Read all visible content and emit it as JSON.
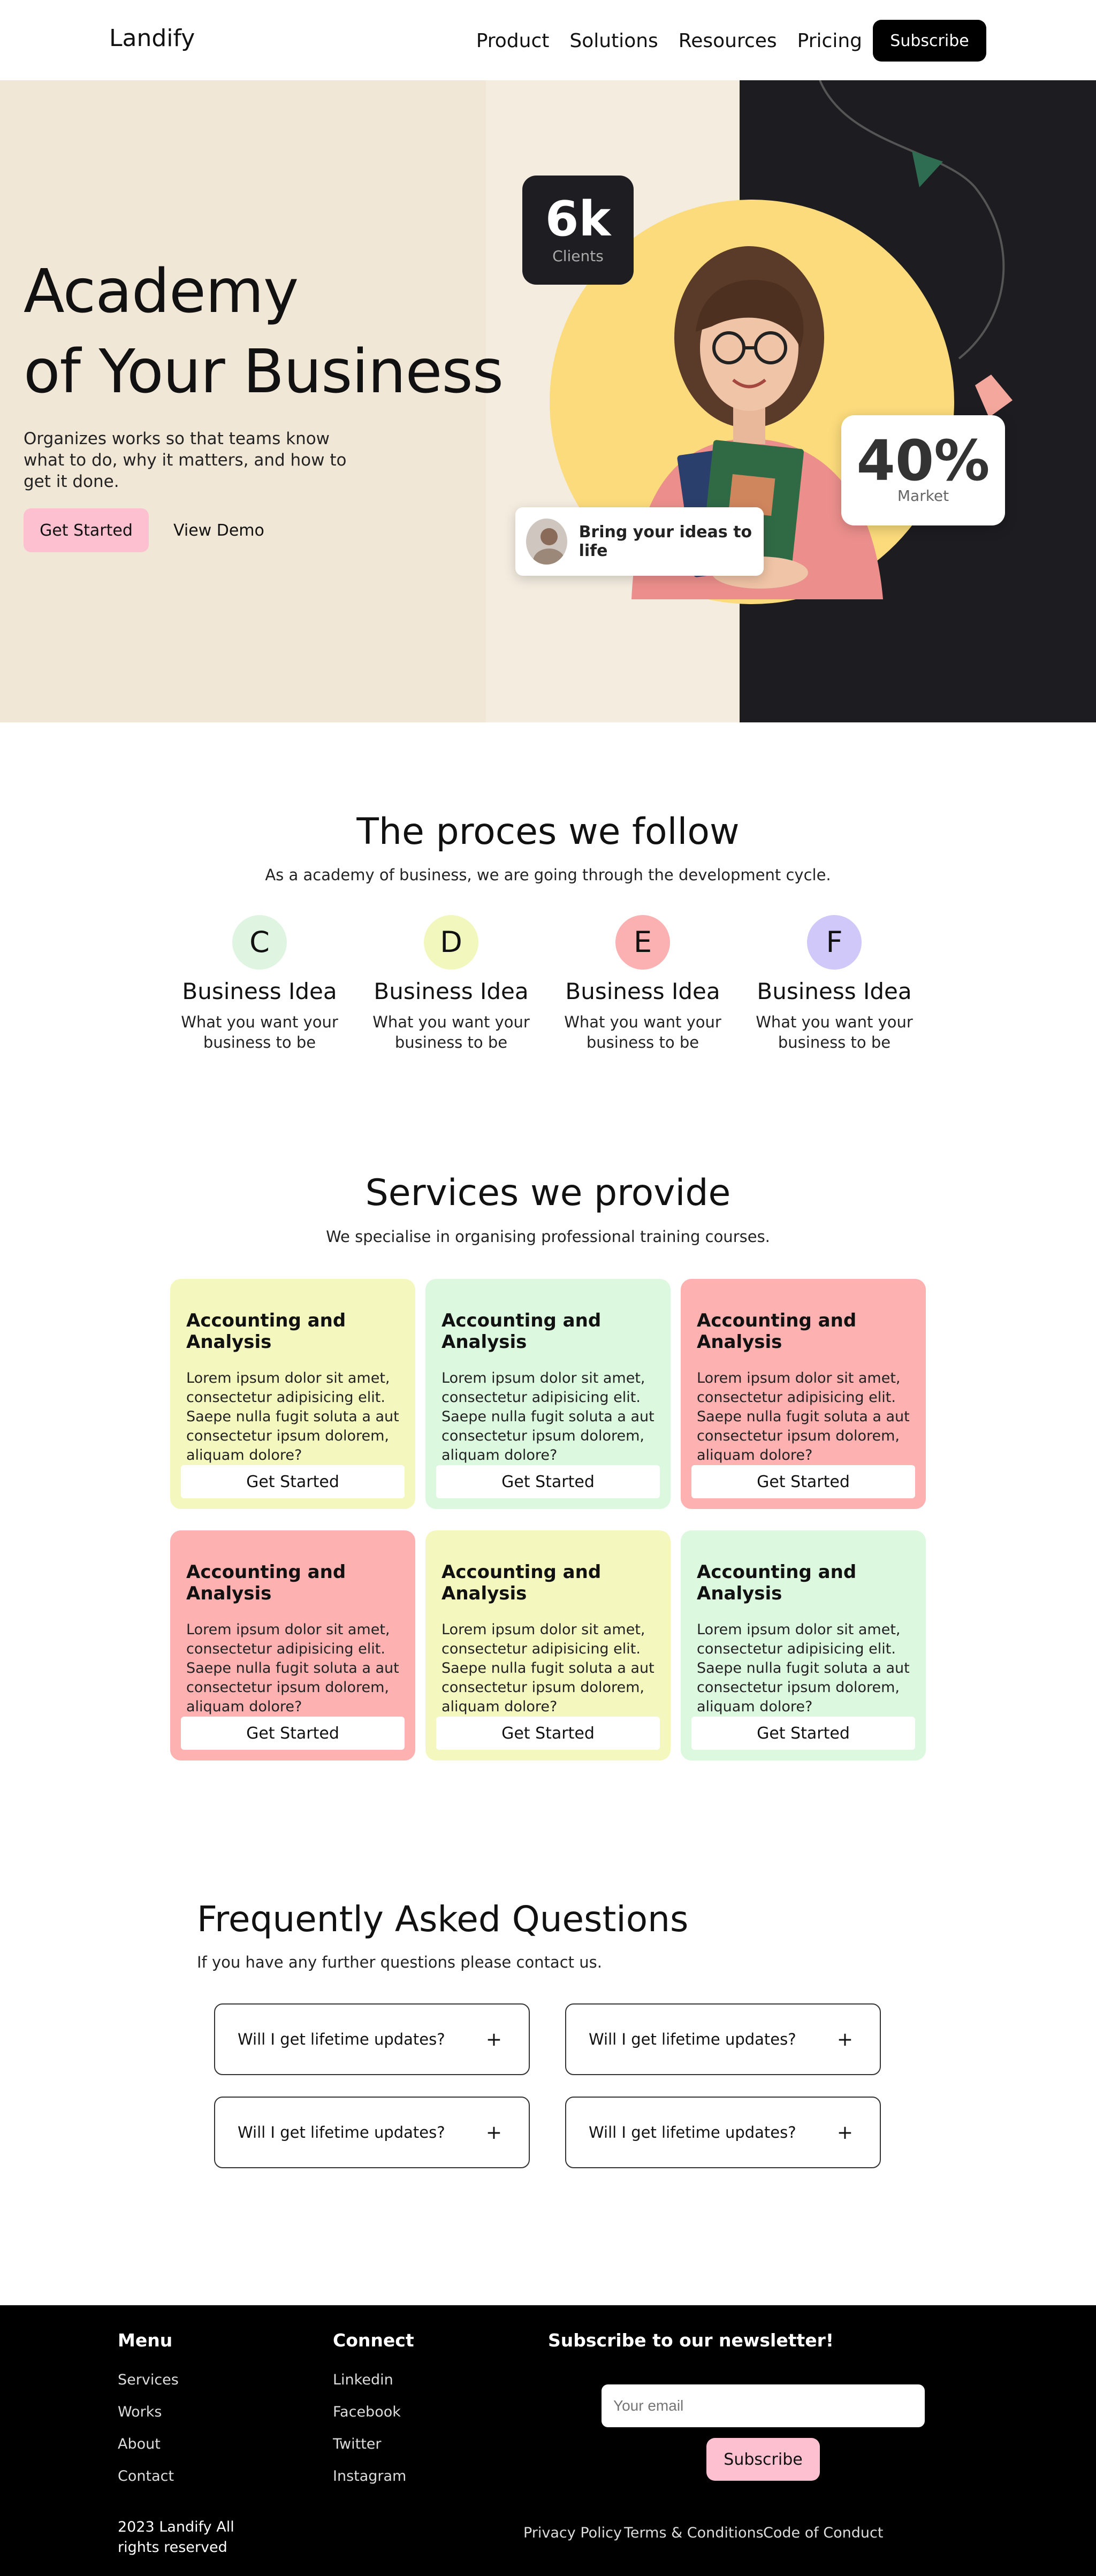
{
  "nav": {
    "logo": "Landify",
    "links": [
      "Product",
      "Solutions",
      "Resources",
      "Pricing"
    ],
    "cta": "Subscribe"
  },
  "hero": {
    "title_line1": "Academy",
    "title_line2": "of Your Business",
    "description": "Organizes works so that teams know what to do, why it matters, and how to get it done.",
    "primary_cta": "Get Started",
    "secondary_cta": "View Demo",
    "stat_clients_value": "6k",
    "stat_clients_label": "Clients",
    "stat_market_value": "40%",
    "stat_market_label": "Market",
    "idea_text": "Bring your ideas to life",
    "colors": {
      "left_bg": "#f1e7d6",
      "right_bg": "#1d1c20",
      "circle": "#fbdb7b",
      "accent": "#fdc0d1"
    }
  },
  "process": {
    "title": "The proces we follow",
    "subtitle": "As a academy of business, we are going through the development cycle.",
    "steps": [
      {
        "letter": "C",
        "title": "Business Idea",
        "desc": "What you want your business to be",
        "color": "#dff5e1"
      },
      {
        "letter": "D",
        "title": "Business Idea",
        "desc": "What you want your business to be",
        "color": "#f2f7be"
      },
      {
        "letter": "E",
        "title": "Business Idea",
        "desc": "What you want your business to be",
        "color": "#fbb1b1"
      },
      {
        "letter": "F",
        "title": "Business Idea",
        "desc": "What you want your business to be",
        "color": "#cfc8f8"
      }
    ]
  },
  "services": {
    "title": "Services we provide",
    "subtitle": "We specialise in organising professional training courses.",
    "cards": [
      {
        "title": "Accounting and Analysis",
        "text": "Lorem ipsum dolor sit amet, consectetur adipisicing elit. Saepe nulla fugit soluta a aut consectetur ipsum dolorem, aliquam dolore?",
        "button": "Get Started",
        "color": "#f4f8bf"
      },
      {
        "title": "Accounting and Analysis",
        "text": "Lorem ipsum dolor sit amet, consectetur adipisicing elit. Saepe nulla fugit soluta a aut consectetur ipsum dolorem, aliquam dolore?",
        "button": "Get Started",
        "color": "#dcf8df"
      },
      {
        "title": "Accounting and Analysis",
        "text": "Lorem ipsum dolor sit amet, consectetur adipisicing elit. Saepe nulla fugit soluta a aut consectetur ipsum dolorem, aliquam dolore?",
        "button": "Get Started",
        "color": "#fdb1b1"
      },
      {
        "title": "Accounting and Analysis",
        "text": "Lorem ipsum dolor sit amet, consectetur adipisicing elit. Saepe nulla fugit soluta a aut consectetur ipsum dolorem, aliquam dolore?",
        "button": "Get Started",
        "color": "#fdb1b1"
      },
      {
        "title": "Accounting and Analysis",
        "text": "Lorem ipsum dolor sit amet, consectetur adipisicing elit. Saepe nulla fugit soluta a aut consectetur ipsum dolorem, aliquam dolore?",
        "button": "Get Started",
        "color": "#f4f8bf"
      },
      {
        "title": "Accounting and Analysis",
        "text": "Lorem ipsum dolor sit amet, consectetur adipisicing elit. Saepe nulla fugit soluta a aut consectetur ipsum dolorem, aliquam dolore?",
        "button": "Get Started",
        "color": "#dcf8df"
      }
    ]
  },
  "faq": {
    "title": "Frequently Asked Questions",
    "subtitle": "If you have any further questions please contact us.",
    "items": [
      {
        "question": "Will I get lifetime updates?",
        "icon": "plus-icon"
      },
      {
        "question": "Will I get lifetime updates?",
        "icon": "plus-icon"
      },
      {
        "question": "Will I get lifetime updates?",
        "icon": "plus-icon"
      },
      {
        "question": "Will I get lifetime updates?",
        "icon": "plus-icon"
      }
    ]
  },
  "footer": {
    "menu_title": "Menu",
    "menu_links": [
      "Services",
      "Works",
      "About",
      "Contact"
    ],
    "connect_title": "Connect",
    "connect_links": [
      "Linkedin",
      "Facebook",
      "Twitter",
      "Instagram"
    ],
    "newsletter_title": "Subscribe to our newsletter!",
    "email_placeholder": "Your email",
    "subscribe_button": "Subscribe",
    "copyright": "2023 Landify All rights reserved",
    "legal_links": [
      "Privacy Policy",
      "Terms & Conditions",
      "Code of Conduct"
    ]
  }
}
